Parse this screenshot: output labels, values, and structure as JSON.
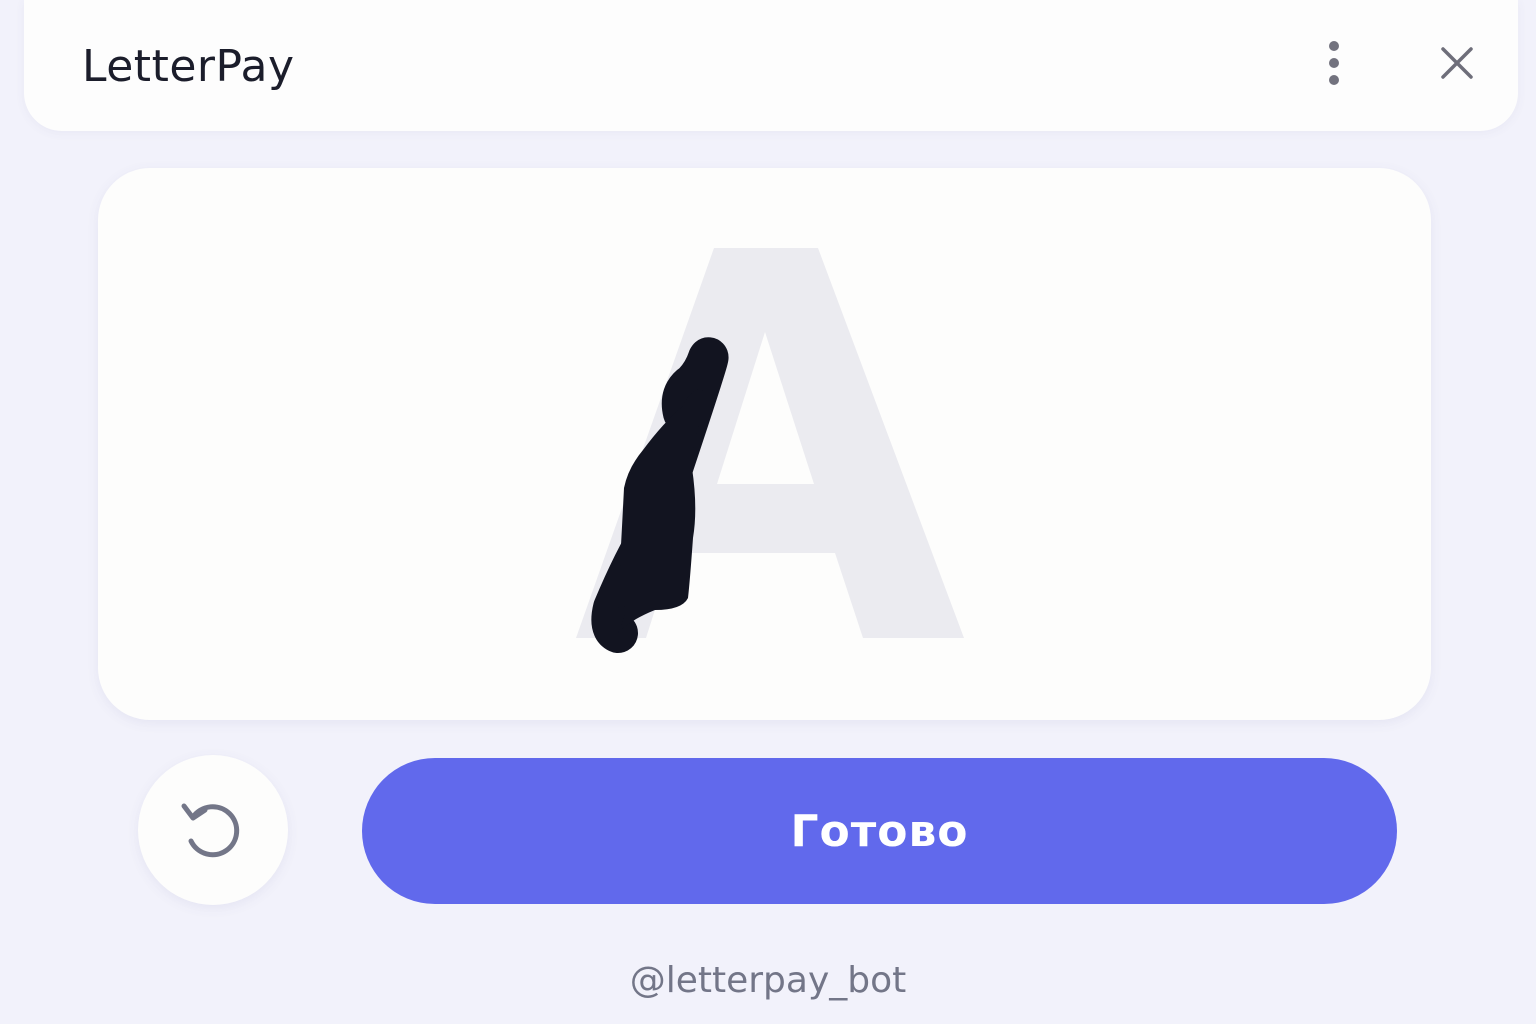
{
  "header": {
    "title": "LetterPay",
    "menu_icon": "more-vertical-icon",
    "close_icon": "close-icon"
  },
  "canvas": {
    "guide_letter": "A",
    "guide_color": "#ebebf0",
    "stroke_color": "#121420"
  },
  "actions": {
    "reset_icon": "rotate-ccw-icon",
    "done_label": "Готово",
    "done_color": "#6169ec"
  },
  "footer": {
    "bot_handle": "@letterpay_bot"
  }
}
